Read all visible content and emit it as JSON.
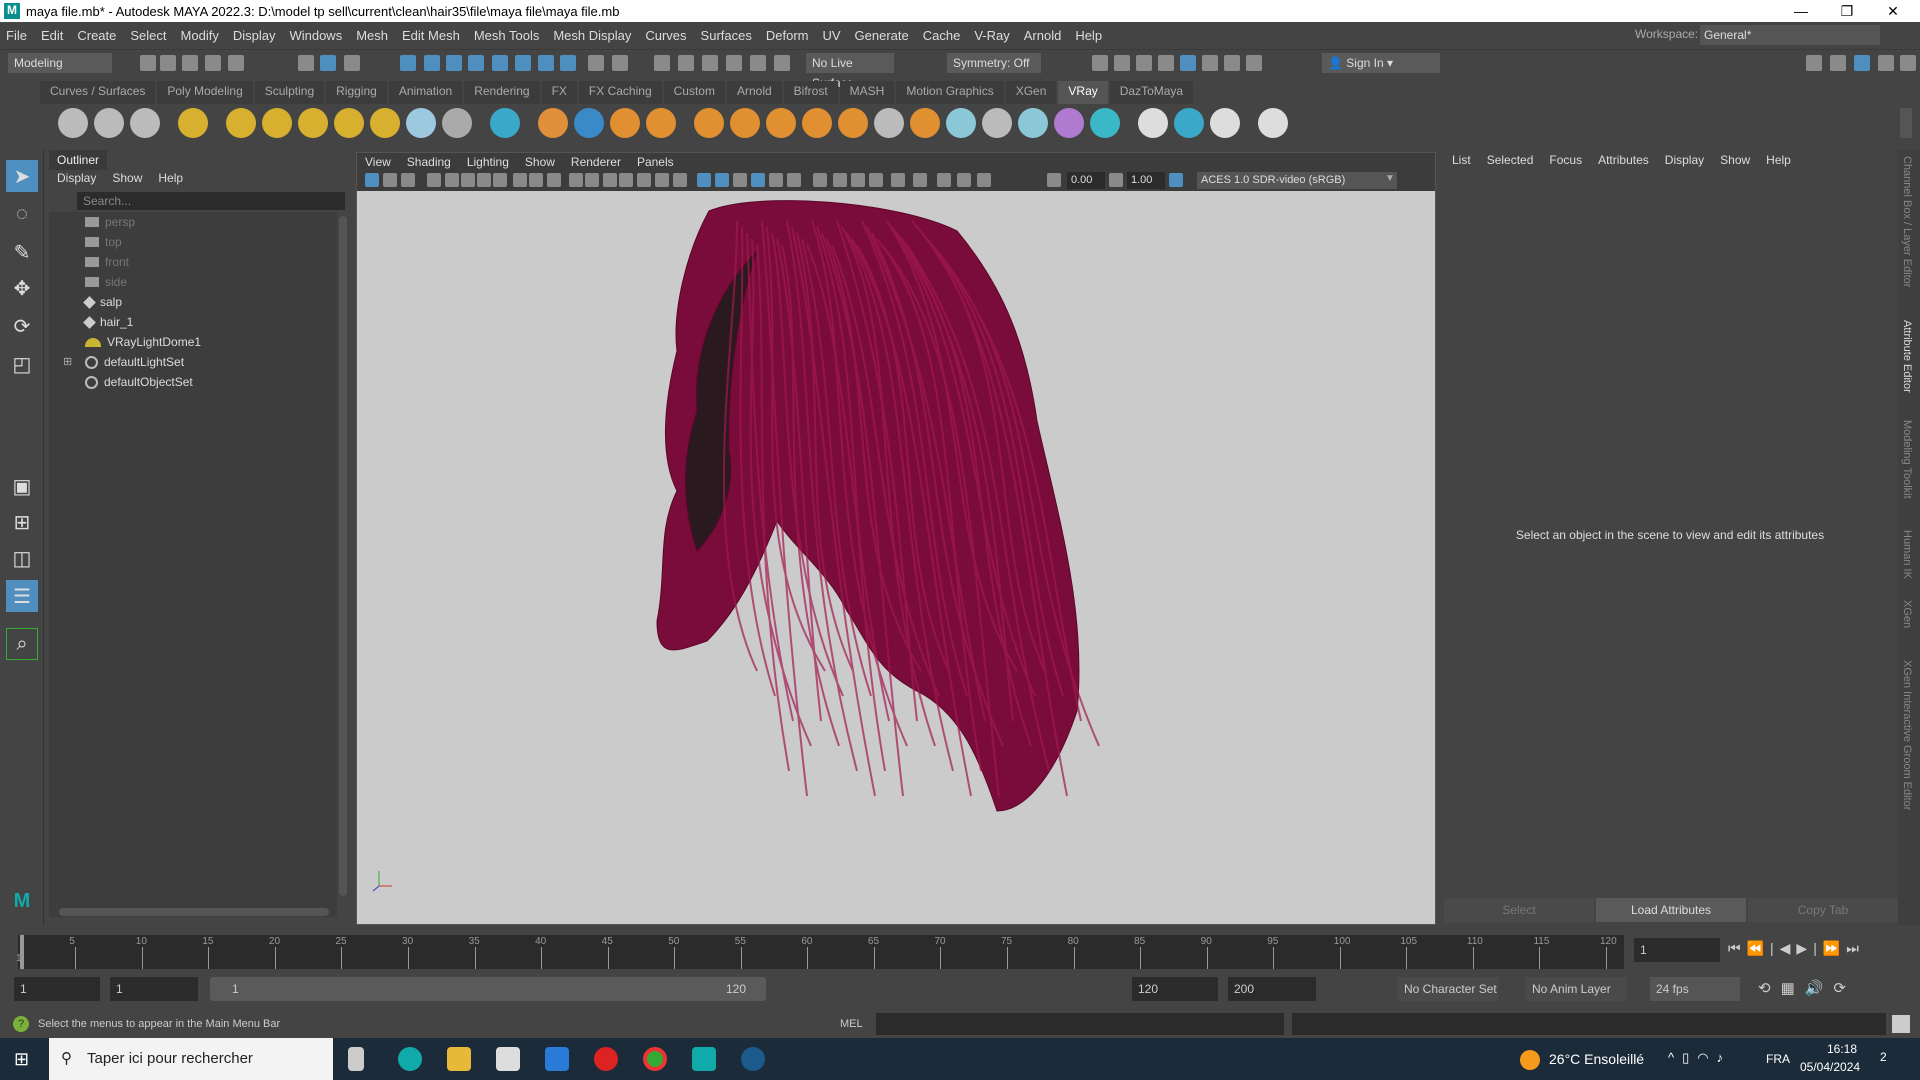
{
  "title": "maya file.mb* - Autodesk MAYA 2022.3: D:\\model tp sell\\current\\clean\\hair35\\file\\maya file\\maya file.mb",
  "window_controls": {
    "minimize": "—",
    "restore": "❐",
    "close": "✕"
  },
  "menubar": [
    "File",
    "Edit",
    "Create",
    "Select",
    "Modify",
    "Display",
    "Windows",
    "Mesh",
    "Edit Mesh",
    "Mesh Tools",
    "Mesh Display",
    "Curves",
    "Surfaces",
    "Deform",
    "UV",
    "Generate",
    "Cache",
    "V-Ray",
    "Arnold",
    "Help"
  ],
  "workspace": {
    "label": "Workspace:",
    "value": "General*"
  },
  "statusline": {
    "menuset": "Modeling",
    "live_surface": "No Live Surface",
    "symmetry": "Symmetry: Off",
    "sign_in": "Sign In"
  },
  "shelf_tabs": [
    "Curves / Surfaces",
    "Poly Modeling",
    "Sculpting",
    "Rigging",
    "Animation",
    "Rendering",
    "FX",
    "FX Caching",
    "Custom",
    "Arnold",
    "Bifrost",
    "MASH",
    "Motion Graphics",
    "XGen",
    "VRay",
    "DazToMaya"
  ],
  "active_shelf": "VRay",
  "outliner": {
    "title": "Outliner",
    "menus": [
      "Display",
      "Show",
      "Help"
    ],
    "search_placeholder": "Search...",
    "items": [
      {
        "label": "persp",
        "type": "camera",
        "dim": true
      },
      {
        "label": "top",
        "type": "camera",
        "dim": true
      },
      {
        "label": "front",
        "type": "camera",
        "dim": true
      },
      {
        "label": "side",
        "type": "camera",
        "dim": true
      },
      {
        "label": "salp",
        "type": "mesh"
      },
      {
        "label": "hair_1",
        "type": "mesh"
      },
      {
        "label": "VRayLightDome1",
        "type": "dome"
      },
      {
        "label": "defaultLightSet",
        "type": "set",
        "expandable": true
      },
      {
        "label": "defaultObjectSet",
        "type": "set"
      }
    ]
  },
  "viewport": {
    "menus": [
      "View",
      "Shading",
      "Lighting",
      "Show",
      "Renderer",
      "Panels"
    ],
    "exposure": "0.00",
    "gamma": "1.00",
    "color_space": "ACES 1.0 SDR-video (sRGB)",
    "hair_color": "#7a0c3c"
  },
  "attribute_editor": {
    "menus": [
      "List",
      "Selected",
      "Focus",
      "Attributes",
      "Display",
      "Show",
      "Help"
    ],
    "message": "Select an object in the scene to view and edit its attributes",
    "buttons": [
      "Select",
      "Load Attributes",
      "Copy Tab"
    ]
  },
  "side_tabs": [
    "Channel Box / Layer Editor",
    "Attribute Editor",
    "Modeling Toolkit",
    "Human IK",
    "XGen",
    "XGen Interactive Groom Editor"
  ],
  "timeline": {
    "ticks": [
      "1",
      "5",
      "10",
      "15",
      "20",
      "25",
      "30",
      "35",
      "40",
      "45",
      "50",
      "55",
      "60",
      "65",
      "70",
      "75",
      "80",
      "85",
      "90",
      "95",
      "100",
      "105",
      "110",
      "115",
      "120"
    ],
    "current_frame": "1"
  },
  "range": {
    "start": "1",
    "playback_start": "1",
    "slider_start": "1",
    "slider_end": "120",
    "playback_end": "120",
    "end": "200",
    "character_set": "No Character Set",
    "anim_layer": "No Anim Layer",
    "fps": "24 fps"
  },
  "command": {
    "help": "Select the menus to appear in the Main Menu Bar",
    "lang": "MEL"
  },
  "taskbar": {
    "search": "Taper ici pour rechercher",
    "weather": "26°C  Ensoleillé",
    "lang": "FRA",
    "time": "16:18",
    "date": "05/04/2024",
    "notifications": "2"
  }
}
